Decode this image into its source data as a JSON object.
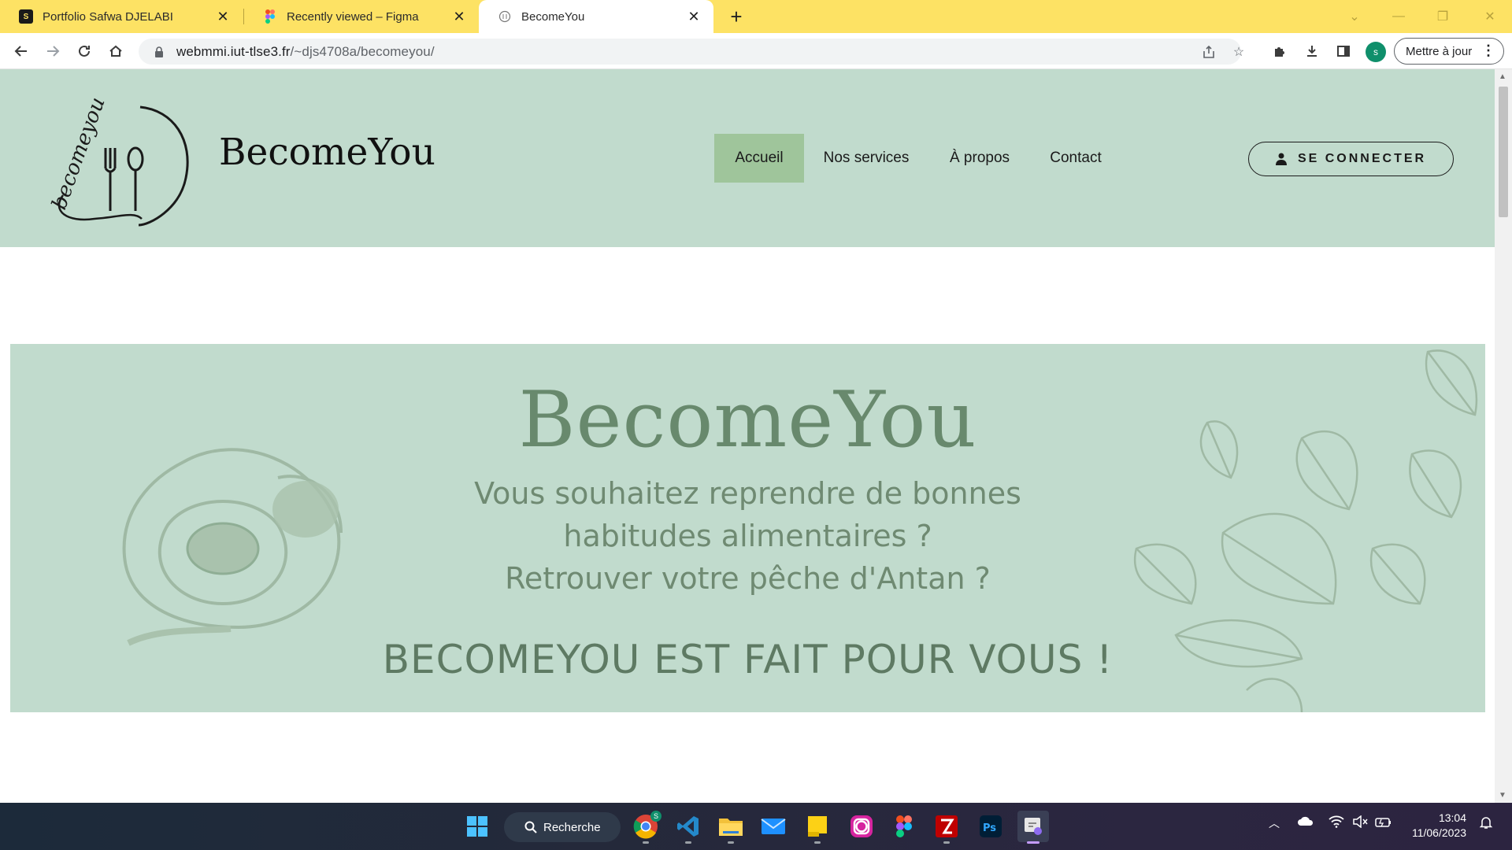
{
  "browser": {
    "tabs": [
      {
        "title": "Portfolio Safwa DJELABI",
        "favicon": "portfolio-favicon",
        "active": false
      },
      {
        "title": "Recently viewed – Figma",
        "favicon": "figma-favicon",
        "active": false
      },
      {
        "title": "BecomeYou",
        "favicon": "site-favicon",
        "active": true
      }
    ],
    "url_host": "webmmi.iut-tlse3.fr",
    "url_path": "/~djs4708a/becomeyou/",
    "profile_initial": "s",
    "update_label": "Mettre à jour",
    "tabstrip_color": "#fde264"
  },
  "site": {
    "brand": "BecomeYou",
    "logo_text": "becomeyou",
    "nav": [
      {
        "label": "Accueil",
        "active": true
      },
      {
        "label": "Nos services",
        "active": false
      },
      {
        "label": "À propos",
        "active": false
      },
      {
        "label": "Contact",
        "active": false
      }
    ],
    "connect_label": "SE CONNECTER",
    "header_color": "#c1dbcd",
    "active_nav_color": "#9fc59b"
  },
  "hero": {
    "title": "BecomeYou",
    "lines": [
      "Vous souhaitez reprendre de bonnes",
      "habitudes alimentaires ?",
      "Retrouver votre pêche d'Antan ?"
    ],
    "cta": "BECOMEYOU EST FAIT POUR VOUS !",
    "background_color": "#c1dbcd",
    "text_color": "#68896d"
  },
  "taskbar": {
    "search_label": "Recherche",
    "time": "13:04",
    "date": "11/06/2023",
    "chrome_badge": "S",
    "apps": [
      "start-icon",
      "chrome-icon",
      "vscode-icon",
      "file-explorer-icon",
      "mail-icon",
      "sticky-notes-icon",
      "instagram-icon",
      "figma-icon",
      "filezilla-icon",
      "photoshop-icon",
      "snipping-tool-icon"
    ]
  }
}
